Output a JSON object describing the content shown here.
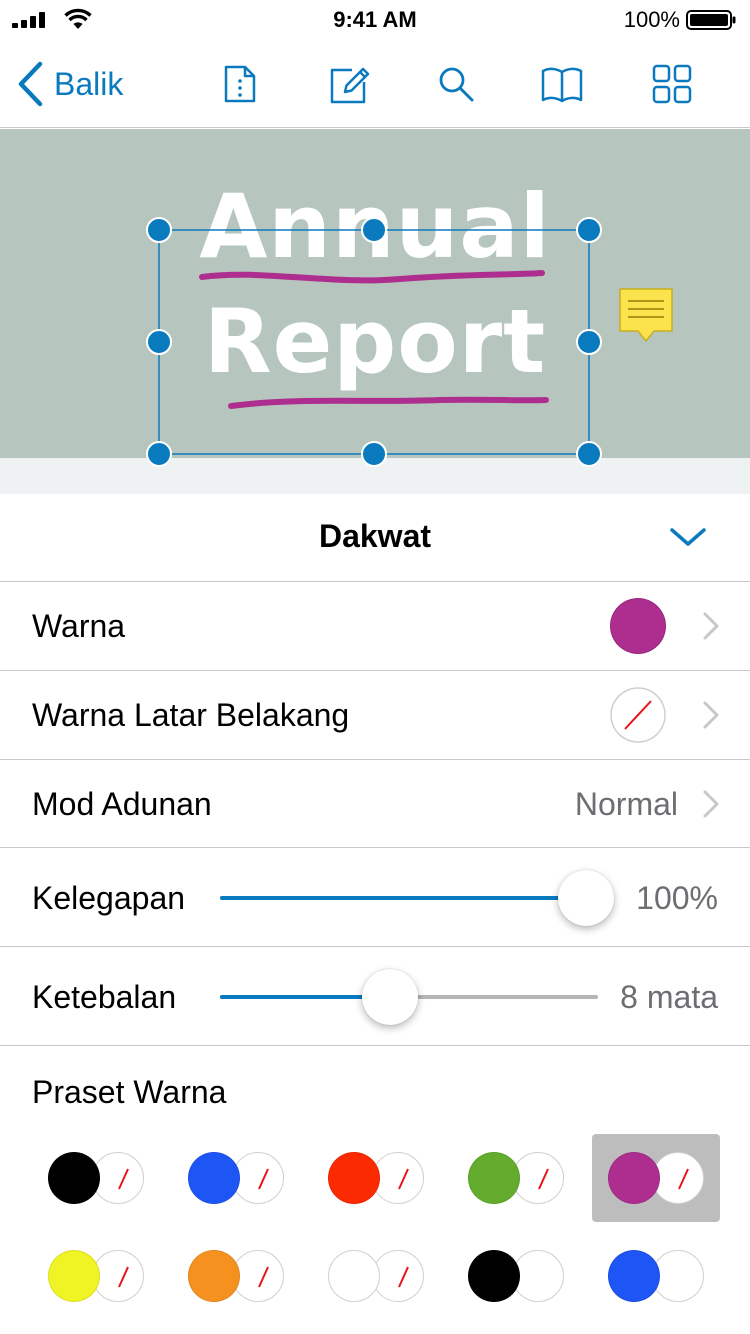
{
  "status_bar": {
    "time": "9:41 AM",
    "battery": "100%"
  },
  "toolbar": {
    "back_label": "Balik",
    "icons": [
      "document-info-icon",
      "annotate-pencil-icon",
      "search-icon",
      "bookmarks-book-icon",
      "thumbnails-grid-icon"
    ]
  },
  "document": {
    "title_line1": "Annual",
    "title_line2": "Report"
  },
  "colors": {
    "accent": "#0a7abf",
    "ink": "#ad2e8e",
    "banner": "#b6c6be",
    "no_color_slash": "#e8141b"
  },
  "panel": {
    "title": "Dakwat",
    "rows": {
      "color": {
        "label": "Warna",
        "swatch": "#ad2e8e"
      },
      "background": {
        "label": "Warna Latar Belakang",
        "swatch": "none"
      },
      "blend": {
        "label": "Mod Adunan",
        "value": "Normal"
      },
      "opacity": {
        "label": "Kelegapan",
        "value": "100%",
        "level": 1.0
      },
      "thickness": {
        "label": "Ketebalan",
        "value": "8 mata",
        "level": 0.45
      }
    },
    "presets_label": "Praset Warna",
    "presets": [
      {
        "ink": "#000000",
        "bg": "none",
        "selected": false
      },
      {
        "ink": "#1e55f5",
        "bg": "none",
        "selected": false
      },
      {
        "ink": "#fc2a00",
        "bg": "none",
        "selected": false
      },
      {
        "ink": "#63ac2e",
        "bg": "none",
        "selected": false
      },
      {
        "ink": "#ad2e8e",
        "bg": "none",
        "selected": true
      },
      {
        "ink": "#f0f324",
        "bg": "none",
        "selected": false
      },
      {
        "ink": "#f5911e",
        "bg": "none",
        "selected": false
      },
      {
        "ink": "#ffffff",
        "bg": "none",
        "selected": false
      },
      {
        "ink": "#000000",
        "bg": "#ffffff",
        "selected": false
      },
      {
        "ink": "#1e55f5",
        "bg": "#ffffff",
        "selected": false
      }
    ]
  }
}
